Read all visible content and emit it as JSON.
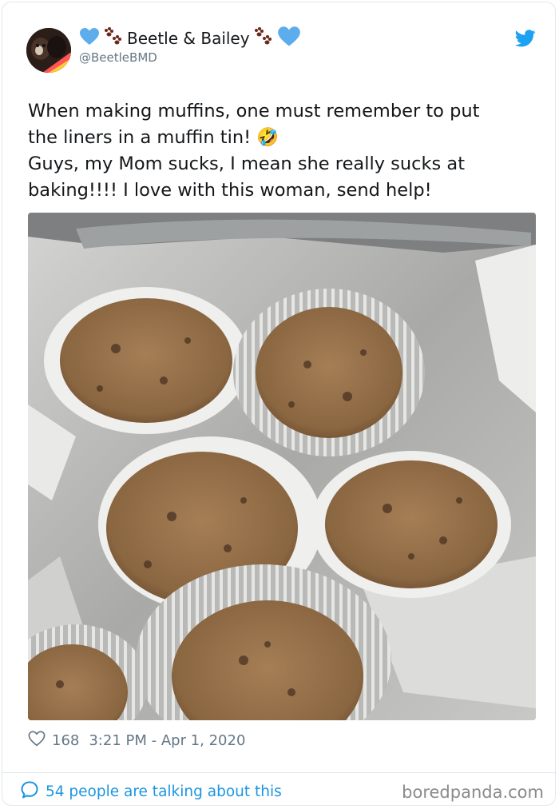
{
  "tweet": {
    "display_name": "Beetle & Bailey",
    "handle": "@BeetleBMD",
    "text_lines": [
      "When making muffins, one must remember to put",
      "the liners in a muffin tin!",
      "Guys, my Mom sucks, I mean she really sucks at",
      "baking!!!! I love with this woman, send help!"
    ],
    "emoji": "🤣",
    "likes": "168",
    "timestamp": "3:21 PM - Apr 1, 2020",
    "conversation": "54 people are talking about this"
  },
  "icons": {
    "name_prefix": [
      "blue-heart-icon",
      "paw-prints-icon"
    ],
    "name_suffix": [
      "paw-prints-icon",
      "blue-heart-icon"
    ],
    "brand": "twitter-bird-icon",
    "like": "heart-outline-icon",
    "reply": "speech-bubble-icon"
  },
  "colors": {
    "accent": "#1da1f2",
    "link": "#1b95e0",
    "text": "#14171a",
    "muted": "#657786"
  },
  "watermark": "boredpanda.com"
}
